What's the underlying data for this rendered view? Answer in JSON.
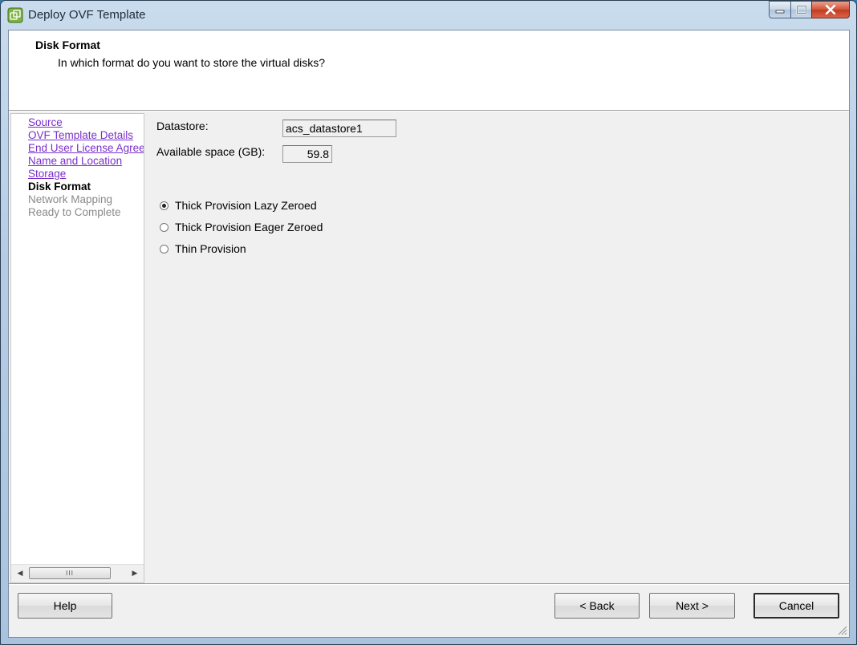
{
  "window": {
    "title": "Deploy OVF Template",
    "controls": {
      "minimize_icon": "minimize-icon",
      "maximize_icon": "maximize-icon",
      "close_icon": "close-icon"
    }
  },
  "header": {
    "title": "Disk Format",
    "subtitle": "In which format do you want to store the virtual disks?"
  },
  "nav": {
    "items": [
      {
        "label": "Source",
        "state": "link"
      },
      {
        "label": "OVF Template Details",
        "state": "link"
      },
      {
        "label": "End User License Agreement",
        "state": "link"
      },
      {
        "label": "Name and Location",
        "state": "link"
      },
      {
        "label": "Storage",
        "state": "link"
      },
      {
        "label": "Disk Format",
        "state": "current"
      },
      {
        "label": "Network Mapping",
        "state": "disabled"
      },
      {
        "label": "Ready to Complete",
        "state": "disabled"
      }
    ],
    "scroll_thumb_glyph": "III"
  },
  "content": {
    "datastore_label": "Datastore:",
    "datastore_value": "acs_datastore1",
    "available_label": "Available space (GB):",
    "available_value": "59.8",
    "options": [
      {
        "label": "Thick Provision Lazy Zeroed",
        "checked": true
      },
      {
        "label": "Thick Provision Eager Zeroed",
        "checked": false
      },
      {
        "label": "Thin Provision",
        "checked": false
      }
    ]
  },
  "footer": {
    "help": "Help",
    "back": "< Back",
    "next": "Next >",
    "cancel": "Cancel"
  },
  "colors": {
    "link": "#7a2fcc",
    "disabled": "#8a8a8a",
    "close_button": "#c23a1e"
  }
}
